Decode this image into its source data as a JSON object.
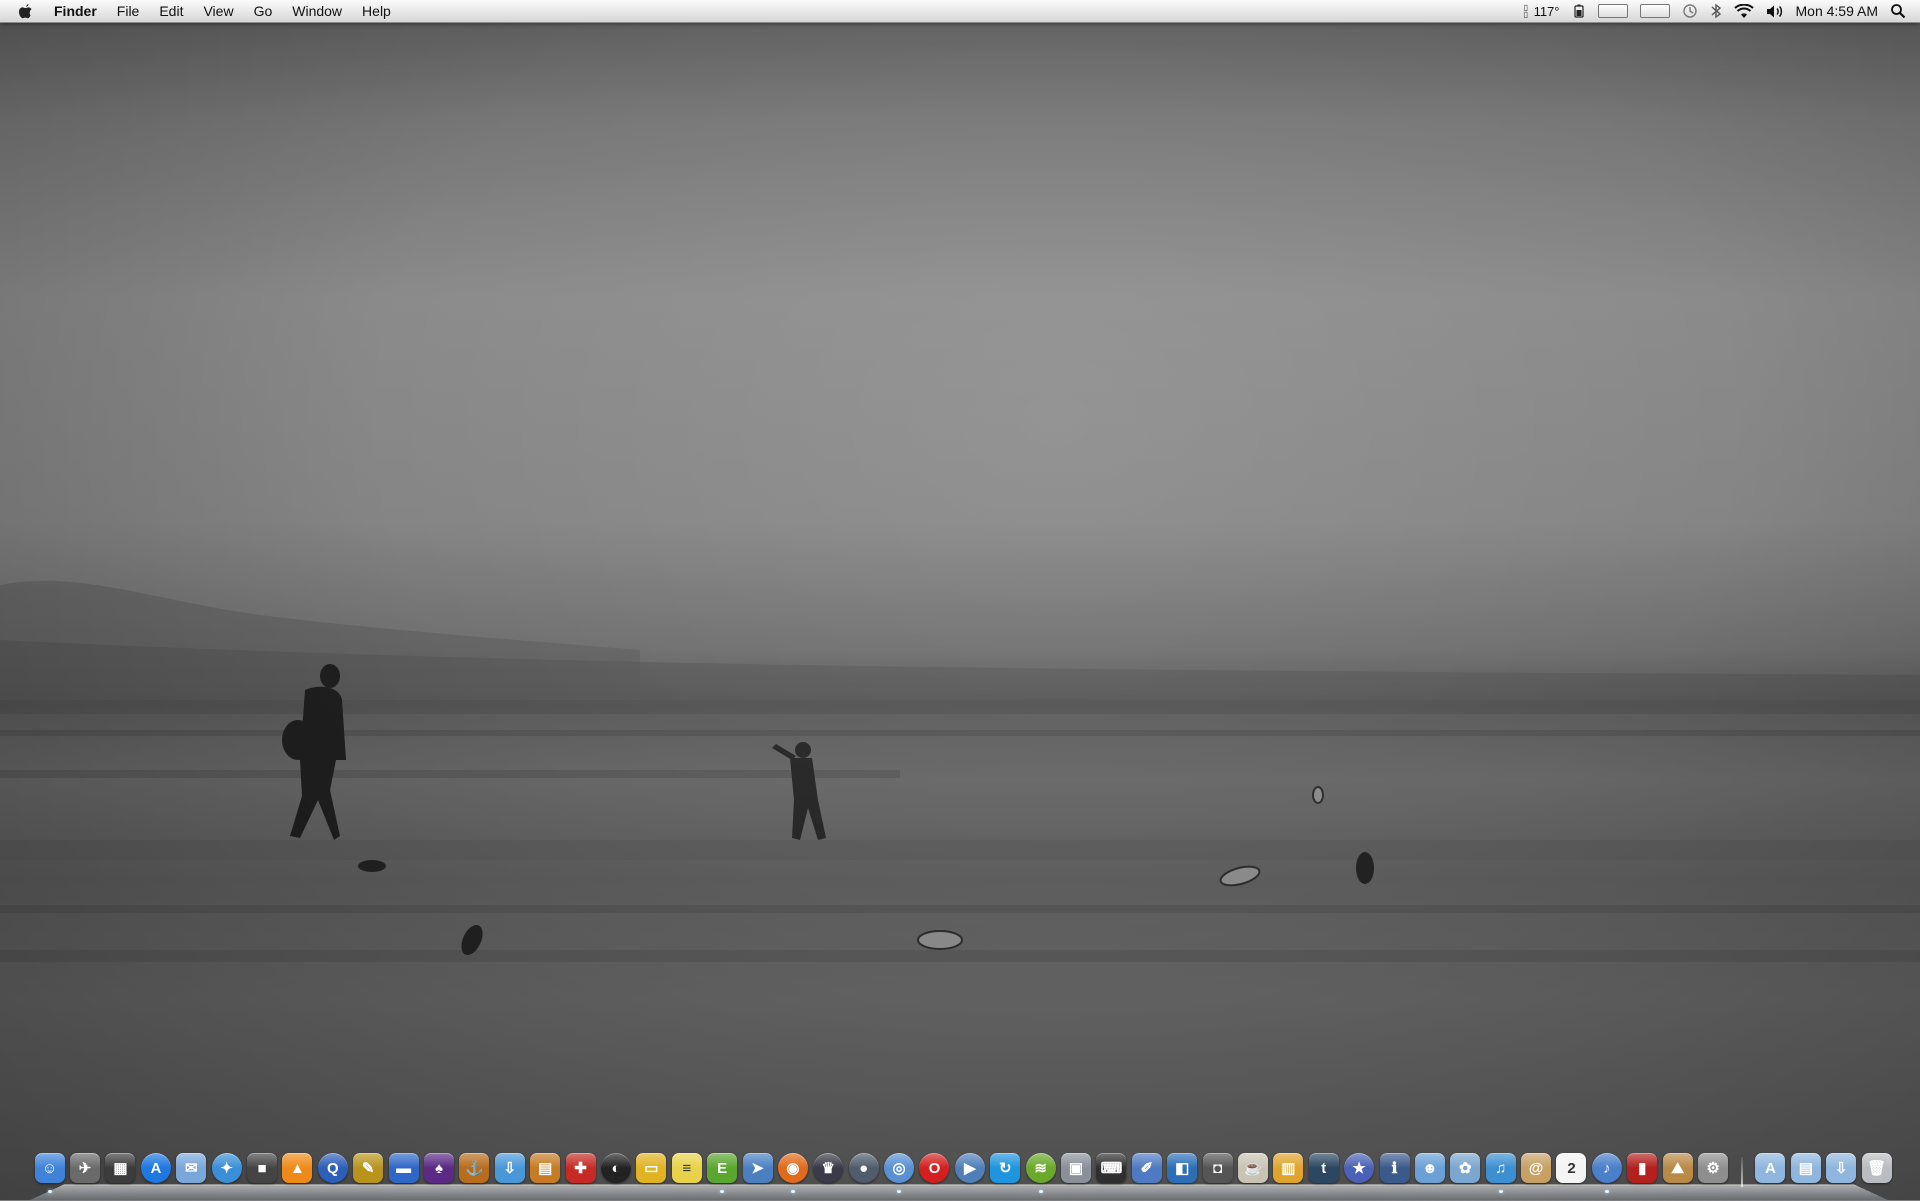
{
  "menubar": {
    "app_name": "Finder",
    "menus": [
      "File",
      "Edit",
      "View",
      "Go",
      "Window",
      "Help"
    ],
    "status": {
      "temperature": "117°",
      "clock": "Mon 4:59 AM"
    },
    "status_icons": [
      "temperature-icon",
      "battery-icon",
      "cpu-meter-icon",
      "memory-meter-icon",
      "time-machine-icon",
      "bluetooth-icon",
      "wifi-icon",
      "volume-icon",
      "spotlight-icon"
    ]
  },
  "dock": {
    "apps": [
      {
        "name": "finder",
        "glyph": "☺",
        "color": "#3f83d9",
        "running": true
      },
      {
        "name": "launchpad",
        "glyph": "✈",
        "color": "#6a6a6a",
        "running": false
      },
      {
        "name": "mission-control",
        "glyph": "▦",
        "color": "#3b3b3b",
        "running": false
      },
      {
        "name": "app-store",
        "glyph": "A",
        "color": "#1e78e0",
        "running": false,
        "round": true
      },
      {
        "name": "mail",
        "glyph": "✉",
        "color": "#7aa7d9",
        "running": false
      },
      {
        "name": "safari",
        "glyph": "✦",
        "color": "#3a8fd8",
        "running": false,
        "round": true
      },
      {
        "name": "facetime",
        "glyph": "■",
        "color": "#444444",
        "running": false
      },
      {
        "name": "vlc",
        "glyph": "▲",
        "color": "#ef8a1a",
        "running": false
      },
      {
        "name": "quicktime",
        "glyph": "Q",
        "color": "#2e5fb8",
        "running": false,
        "round": true
      },
      {
        "name": "feather-app",
        "glyph": "✎",
        "color": "#b8941c",
        "running": false
      },
      {
        "name": "sidebar-app",
        "glyph": "▬",
        "color": "#2f67c6",
        "running": false
      },
      {
        "name": "wizard-app",
        "glyph": "♠",
        "color": "#5a2a85",
        "running": false
      },
      {
        "name": "sync-app",
        "glyph": "⚓",
        "color": "#b86c1d",
        "running": false
      },
      {
        "name": "downloader",
        "glyph": "⇩",
        "color": "#4a97d8",
        "running": false
      },
      {
        "name": "archive-app",
        "glyph": "▤",
        "color": "#c77b24",
        "running": false
      },
      {
        "name": "toolbox-app",
        "glyph": "✚",
        "color": "#c52b24",
        "running": false
      },
      {
        "name": "time-app",
        "glyph": "◐",
        "color": "#222222",
        "running": false,
        "round": true
      },
      {
        "name": "copy-box",
        "glyph": "▭",
        "color": "#e1b222",
        "running": false
      },
      {
        "name": "stickies",
        "glyph": "≡",
        "color": "#e8d24a",
        "running": false
      },
      {
        "name": "evernote",
        "glyph": "E",
        "color": "#5aa72f",
        "running": true
      },
      {
        "name": "sparrow",
        "glyph": "➤",
        "color": "#4a7fc0",
        "running": false
      },
      {
        "name": "firefox",
        "glyph": "◉",
        "color": "#e26a1c",
        "running": true,
        "round": true
      },
      {
        "name": "alfred",
        "glyph": "♛",
        "color": "#3a3a48",
        "running": false,
        "round": true
      },
      {
        "name": "steam",
        "glyph": "●",
        "color": "#4f5c6b",
        "running": false,
        "round": true
      },
      {
        "name": "chrome",
        "glyph": "◎",
        "color": "#5890d2",
        "running": true,
        "round": true
      },
      {
        "name": "opera",
        "glyph": "O",
        "color": "#d3201f",
        "running": false,
        "round": true
      },
      {
        "name": "player",
        "glyph": "▶",
        "color": "#4f7fb8",
        "running": false,
        "round": true
      },
      {
        "name": "sync-blue",
        "glyph": "↻",
        "color": "#1e95de",
        "running": false
      },
      {
        "name": "spotify",
        "glyph": "≋",
        "color": "#6aa92b",
        "running": true,
        "round": true
      },
      {
        "name": "preview",
        "glyph": "▣",
        "color": "#8a8f99",
        "running": false
      },
      {
        "name": "terminal-app",
        "glyph": "⌨",
        "color": "#2f2f2f",
        "running": false
      },
      {
        "name": "script-app",
        "glyph": "✐",
        "color": "#4d7ac2",
        "running": false
      },
      {
        "name": "contrast-app",
        "glyph": "◧",
        "color": "#2d6fb7",
        "running": false
      },
      {
        "name": "camera-app",
        "glyph": "◘",
        "color": "#555555",
        "running": false
      },
      {
        "name": "coffee-app",
        "glyph": "☕",
        "color": "#c9c3b4",
        "running": false
      },
      {
        "name": "color-app",
        "glyph": "▥",
        "color": "#e0a42c",
        "running": false
      },
      {
        "name": "tumblr",
        "glyph": "t",
        "color": "#2c4762",
        "running": false
      },
      {
        "name": "star-app",
        "glyph": "★",
        "color": "#4a62b5",
        "running": false,
        "round": true
      },
      {
        "name": "instastats",
        "glyph": "ℹ",
        "color": "#3b5a8c",
        "running": false
      },
      {
        "name": "adium",
        "glyph": "☻",
        "color": "#6aa0d6",
        "running": false
      },
      {
        "name": "photo-app",
        "glyph": "✿",
        "color": "#7aa6cf",
        "running": false
      },
      {
        "name": "twitter",
        "glyph": "♫",
        "color": "#3c8fd1",
        "running": true
      },
      {
        "name": "contacts",
        "glyph": "@",
        "color": "#c7a064",
        "running": false
      },
      {
        "name": "calendar",
        "glyph": "2",
        "color": "#f4f4f4",
        "running": false
      },
      {
        "name": "itunes",
        "glyph": "♪",
        "color": "#4a7fc9",
        "running": true,
        "round": true
      },
      {
        "name": "photo-booth",
        "glyph": "▮",
        "color": "#b3201d",
        "running": false
      },
      {
        "name": "iphoto",
        "glyph": "⛰",
        "color": "#b88a46",
        "running": false
      },
      {
        "name": "system-preferences",
        "glyph": "⚙",
        "color": "#8e8e8e",
        "running": false
      }
    ],
    "stacks": [
      {
        "name": "applications-folder",
        "glyph": "A",
        "color": "#8fb6de"
      },
      {
        "name": "documents-folder",
        "glyph": "▤",
        "color": "#8fb6de"
      },
      {
        "name": "downloads-folder",
        "glyph": "⇩",
        "color": "#8fb6de"
      },
      {
        "name": "trash",
        "glyph": "🗑",
        "color": "#b9bcc0"
      }
    ]
  }
}
